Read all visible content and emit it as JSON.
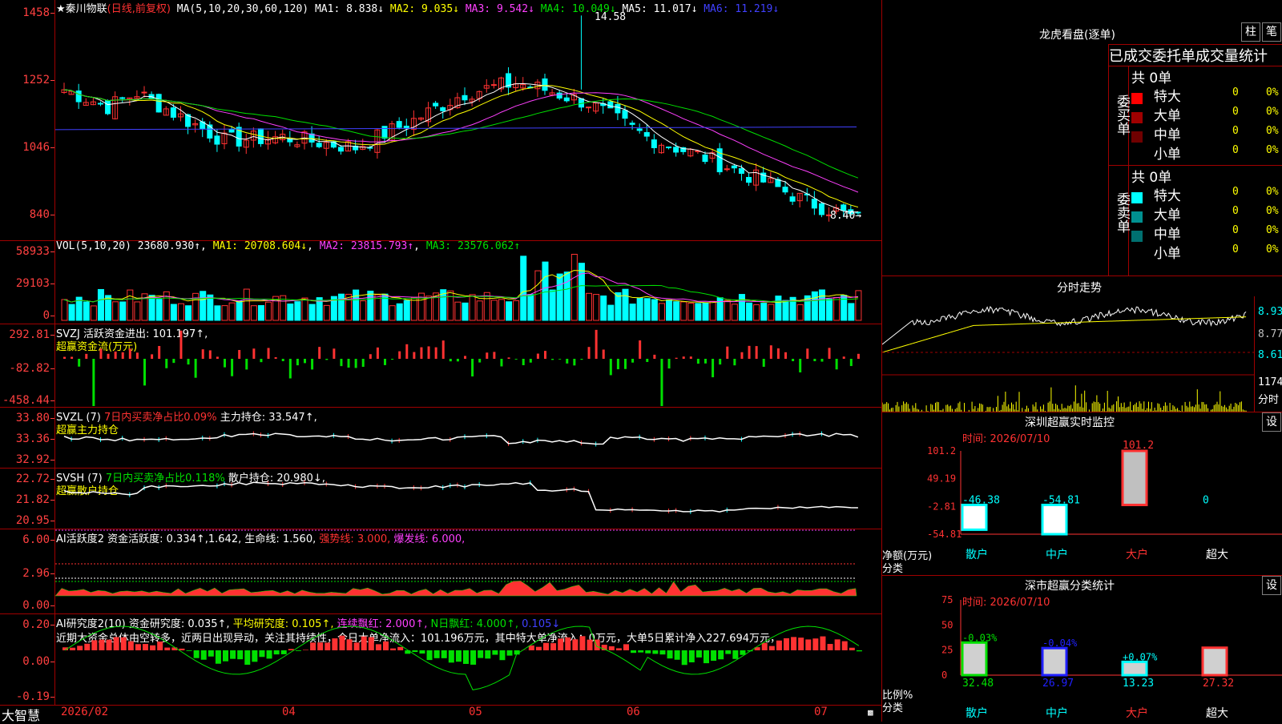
{
  "colors": {
    "red": "#ff3232",
    "cyan": "#00ffff",
    "green": "#00e000",
    "yellow": "#ffff00",
    "magenta": "#ff40ff",
    "blue": "#4040ff",
    "white": "#ffffff"
  },
  "main": {
    "legend": {
      "title": "★秦川物联",
      "period": "(日线,前复权)",
      "ma_label": "MA(5,10,20,30,60,120)",
      "ma1": "MA1: 8.838↓",
      "ma2": "MA2: 9.035↓",
      "ma3": "MA3: 9.542↓",
      "ma4": "MA4: 10.049↓",
      "ma5": "MA5: 11.017↓",
      "ma6": "MA6: 11.219↓"
    },
    "y_ticks": [
      "1458",
      "1252",
      "1046",
      "840"
    ],
    "high_label": "14.58",
    "low_label": "8.40→"
  },
  "vol": {
    "legend_name": "VOL(5,10,20)",
    "value": "23680.930↑",
    "ma1": "MA1: 20708.604↓",
    "ma2": "MA2: 23815.793↑",
    "ma3": "MA3: 23576.062↑",
    "y_ticks": [
      "58933",
      "29103",
      "0"
    ]
  },
  "svzj": {
    "legend": "SVZJ  活跃资金进出: 101.197↑,",
    "sub": "超赢资金流(万元)",
    "y_ticks": [
      "292.81",
      "-82.82",
      "-458.44"
    ]
  },
  "svzl": {
    "legend_name": "SVZL (7)",
    "legend_a": "7日内买卖净占比0.09%",
    "legend_b": "主力持仓: 33.547↑,",
    "sub": "超赢主力持仓",
    "y_ticks": [
      "33.80",
      "33.36",
      "32.92"
    ]
  },
  "svsh": {
    "legend_name": "SVSH (7)",
    "legend_a": "7日内买卖净占比0.118%",
    "legend_b": "散户持仓: 20.980↓,",
    "sub": "超赢散户持仓",
    "y_ticks": [
      "22.72",
      "21.82",
      "20.95"
    ]
  },
  "ai1": {
    "legend_a": "AI活跃度2 资金活跃度: 0.334↑,1.642,",
    "legend_b": "生命线: 1.560,",
    "legend_c": "强势线: 3.000,",
    "legend_d": "爆发线: 6.000,",
    "y_ticks": [
      "6.00",
      "2.96",
      "0.00"
    ]
  },
  "ai2": {
    "legend_a": "AI研究度2(10) 资金研究度: 0.035↑,",
    "legend_b": "平均研究度: 0.105↑,",
    "legend_c": "连续飘红: 2.000↑,",
    "legend_d": "N日飘红: 4.000↑,",
    "legend_e": "0.105↓",
    "comment": "近期大资金总体由空转多，近两日出现异动，关注其持续性，今日大单净流入：101.196万元，其中特大单净流入：0万元，大单5日累计净入227.694万元，",
    "y_ticks": [
      "0.20",
      "0.00",
      "-0.19"
    ]
  },
  "xaxis": {
    "labels": [
      "2026/02",
      "04",
      "05",
      "06",
      "07"
    ],
    "brand": "大智慧"
  },
  "dragon": {
    "title": "龙虎看盘(逐单)",
    "btn1": "柱",
    "btn2": "笔",
    "subtitle": "已成交委托单成交量统计",
    "buy_side": "委买单",
    "sell_side": "委卖单",
    "buy_total": "共 0单",
    "sell_total": "共 0单",
    "rows": [
      {
        "label": "特大",
        "count": "0",
        "pct": "0%"
      },
      {
        "label": "大单",
        "count": "0",
        "pct": "0%"
      },
      {
        "label": "中单",
        "count": "0",
        "pct": "0%"
      },
      {
        "label": "小单",
        "count": "0",
        "pct": "0%"
      }
    ]
  },
  "intraday": {
    "title": "分时走势",
    "ticks": [
      "8.93",
      "8.77",
      "8.61"
    ],
    "vol_tick": "1174",
    "vol_label": "分时"
  },
  "monitor": {
    "title": "深圳超赢实时监控",
    "set": "设",
    "time": "时间: 2026/07/10",
    "y_ticks": [
      "101.2",
      "49.19",
      "-2.81",
      "-54.81"
    ],
    "ylabel": "净额(万元)",
    "xlabel": "分类",
    "cats": [
      "散户",
      "中户",
      "大户",
      "超大"
    ],
    "values": [
      -46.38,
      -54.81,
      101.2,
      0
    ],
    "value_labels": [
      "-46.38",
      "-54.81",
      "101.2",
      "0"
    ]
  },
  "classify": {
    "title": "深市超赢分类统计",
    "set": "设",
    "time": "时间: 2026/07/10",
    "y_ticks": [
      "75",
      "50",
      "25",
      "0"
    ],
    "ylabel": "比例%",
    "xlabel": "分类",
    "cats": [
      "散户",
      "中户",
      "大户",
      "超大"
    ],
    "values": [
      32.48,
      26.97,
      13.23,
      27.32
    ],
    "value_labels": [
      "32.48",
      "26.97",
      "13.23",
      "27.32"
    ],
    "change_labels": [
      "-0.03%",
      "-0.04%",
      "+0.07%",
      ""
    ]
  }
}
